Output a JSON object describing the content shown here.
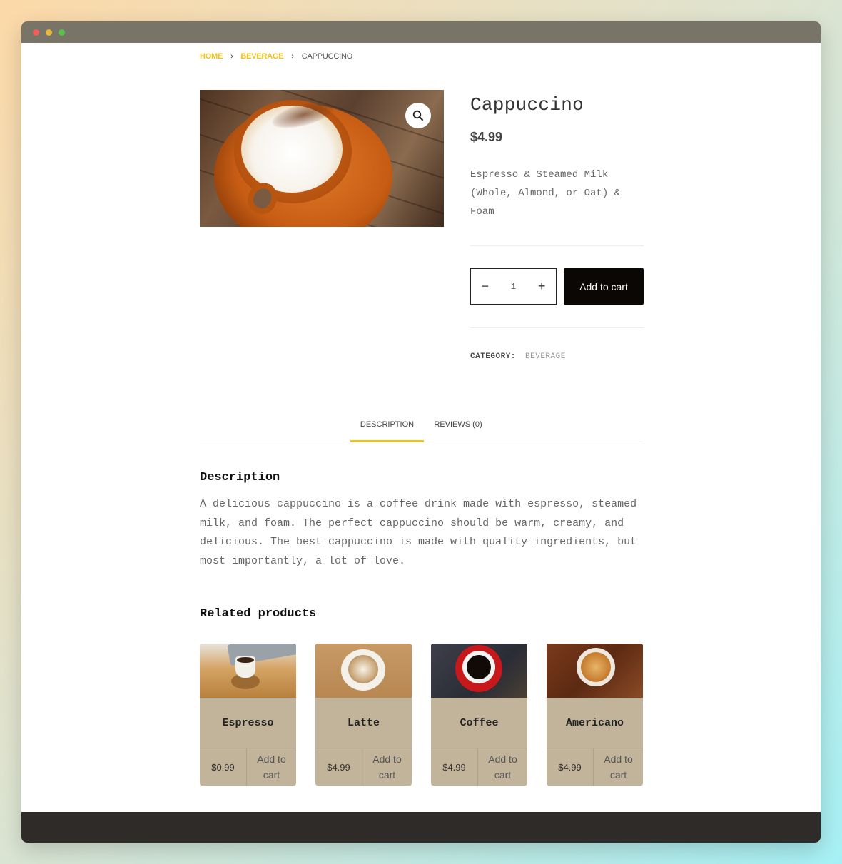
{
  "breadcrumb": {
    "home": "HOME",
    "category": "BEVERAGE",
    "current": "CAPPUCCINO",
    "separator": "›"
  },
  "product": {
    "title": "Cappuccino",
    "price": "$4.99",
    "short_description": "Espresso & Steamed Milk (Whole, Almond, or Oat) & Foam",
    "quantity": "1",
    "add_to_cart_label": "Add to cart",
    "category_label": "CATEGORY:",
    "category_value": "BEVERAGE"
  },
  "tabs": {
    "description_label": "DESCRIPTION",
    "reviews_label": "REVIEWS (0)"
  },
  "description": {
    "heading": "Description",
    "text": "A delicious cappuccino is a coffee drink made with espresso, steamed milk, and foam. The perfect cappuccino should be warm, creamy, and delicious. The best cappuccino is made with quality ingredients, but most importantly, a lot of love."
  },
  "related": {
    "heading": "Related products",
    "items": [
      {
        "name": "Espresso",
        "price": "$0.99",
        "add_label": "Add to cart"
      },
      {
        "name": "Latte",
        "price": "$4.99",
        "add_label": "Add to cart"
      },
      {
        "name": "Coffee",
        "price": "$4.99",
        "add_label": "Add to cart"
      },
      {
        "name": "Americano",
        "price": "$4.99",
        "add_label": "Add to cart"
      }
    ]
  },
  "colors": {
    "accent": "#f2bf1c",
    "button": "#0a0705",
    "card_bg": "#c1b49b",
    "footer": "#2e2b28"
  },
  "icons": {
    "zoom": "magnifier-icon",
    "minus": "minus-icon",
    "plus": "plus-icon"
  }
}
